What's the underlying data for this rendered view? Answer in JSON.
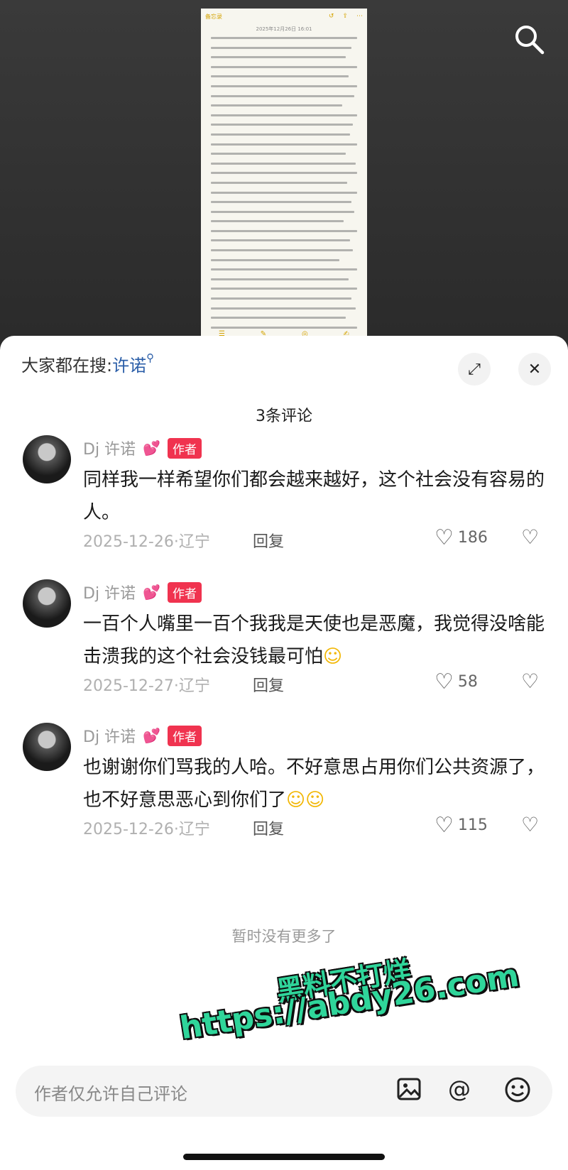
{
  "note": {
    "back_label": "备忘录",
    "date": "2025年12月26日 16:01"
  },
  "sheet": {
    "search_prefix": "大家都在搜:",
    "search_keyword": "许诺",
    "comment_count": "3条评论",
    "no_more": "暂时没有更多了"
  },
  "comments": [
    {
      "author": "Dj 许诺",
      "badge": "作者",
      "text": "同样我一样希望你们都会越来越好，这个社会没有容易的人。",
      "date_location": "2025-12-26·辽宁",
      "reply": "回复",
      "likes": "186"
    },
    {
      "author": "Dj 许诺",
      "badge": "作者",
      "text": "一百个人嘴里一百个我我是天使也是恶魔，我觉得没啥能击溃我的这个社会没钱最可怕",
      "date_location": "2025-12-27·辽宁",
      "reply": "回复",
      "likes": "58"
    },
    {
      "author": "Dj 许诺",
      "badge": "作者",
      "text": "也谢谢你们骂我的人哈。不好意思占用你们公共资源了，也不好意思恶心到你们了",
      "date_location": "2025-12-26·辽宁",
      "reply": "回复",
      "likes": "115"
    }
  ],
  "watermark": {
    "line1": "黑料不打烊",
    "line2": "https://abdy26.com"
  },
  "input": {
    "placeholder": "作者仅允许自己评论"
  },
  "icons": {
    "search": "search-icon",
    "expand": "expand-icon",
    "close": "close-icon",
    "like": "heart-outline-icon",
    "dislike": "broken-heart-icon",
    "image": "image-icon",
    "mention": "at-icon",
    "emoji": "emoji-icon"
  },
  "colors": {
    "badge": "#f0334f",
    "keyword": "#2b5ea8",
    "watermark": "#2fd59a"
  }
}
